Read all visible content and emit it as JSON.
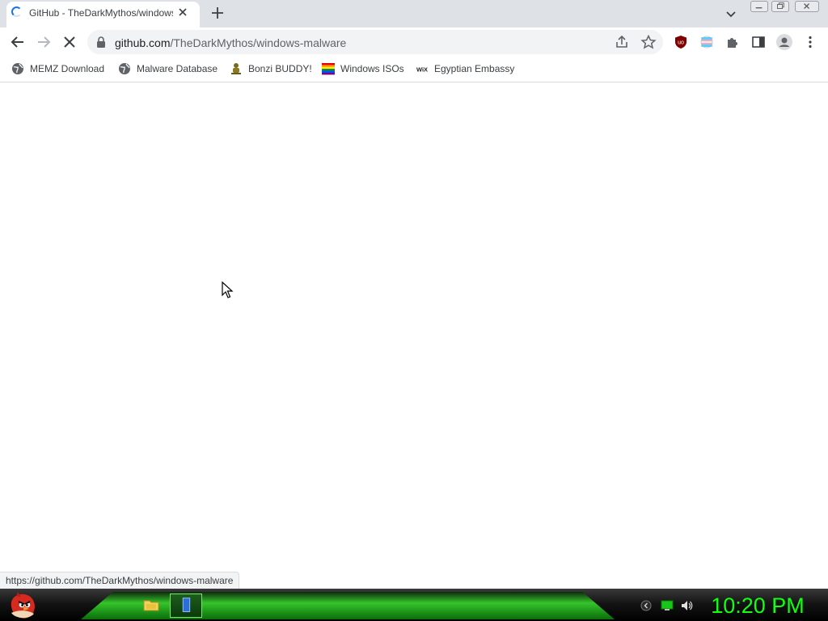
{
  "tab": {
    "title": "GitHub - TheDarkMythos/windows-malware",
    "icon": "loading-spinner-icon"
  },
  "window_controls": [
    "minimize-icon",
    "restore-icon",
    "close-icon"
  ],
  "toolbar": {
    "url_host": "github.com",
    "url_path": "/TheDarkMythos/windows-malware",
    "buttons": [
      "back-icon",
      "forward-icon",
      "stop-loading-icon",
      "share-icon",
      "star-icon",
      "ublock-icon",
      "extension-flag-icon",
      "puzzle-icon",
      "side-panel-icon",
      "profile-icon",
      "menu-icon"
    ]
  },
  "bookmarks": [
    {
      "label": "MEMZ Download",
      "icon": "globe-icon"
    },
    {
      "label": "Malware Database",
      "icon": "globe-icon"
    },
    {
      "label": "Bonzi BUDDY!",
      "icon": "bonzi-icon"
    },
    {
      "label": "Windows ISOs",
      "icon": "rainbow-flag-icon"
    },
    {
      "label": "Egyptian Embassy",
      "icon": "wix-icon"
    }
  ],
  "status_bar": {
    "link_url": "https://github.com/TheDarkMythos/windows-malware"
  },
  "taskbar": {
    "clock": "10:20 PM",
    "items": [
      "start-orb-icon",
      "file-explorer-icon",
      "chrome-window-icon"
    ],
    "tray": [
      "tray-overflow-icon",
      "network-icon",
      "volume-icon"
    ],
    "accent_color": "#12ff12"
  }
}
